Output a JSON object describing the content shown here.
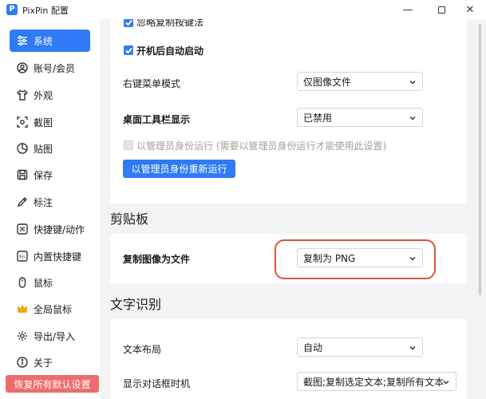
{
  "window": {
    "title": "PixPin 配置",
    "app_icon_letter": "P",
    "minimize_glyph": "—",
    "close_glyph": "✕"
  },
  "sidebar": {
    "items": [
      {
        "label": "系统",
        "icon": "sliders-icon",
        "active": true
      },
      {
        "label": "账号/会员",
        "icon": "user-circle-icon",
        "active": false
      },
      {
        "label": "外观",
        "icon": "shirt-icon",
        "active": false
      },
      {
        "label": "截图",
        "icon": "screenshot-icon",
        "active": false
      },
      {
        "label": "贴图",
        "icon": "pin-image-icon",
        "active": false
      },
      {
        "label": "保存",
        "icon": "save-icon",
        "active": false
      },
      {
        "label": "标注",
        "icon": "annotate-icon",
        "active": false
      },
      {
        "label": "快捷键/动作",
        "icon": "command-key-icon",
        "active": false
      },
      {
        "label": "内置快捷键",
        "icon": "fn-key-icon",
        "active": false
      },
      {
        "label": "鼠标",
        "icon": "mouse-icon",
        "active": false
      },
      {
        "label": "全局鼠标",
        "icon": "crown-icon",
        "active": false
      },
      {
        "label": "导出/导入",
        "icon": "gear-export-icon",
        "active": false
      },
      {
        "label": "关于",
        "icon": "info-icon",
        "active": false
      }
    ],
    "reset_button": "恢复所有默认设置",
    "accent_color": "#2f7bf5",
    "reset_color": "#ef6c6c"
  },
  "system_card": {
    "ignore_copy_key_label": "忽略复制按键法",
    "autostart_label": "开机后自动启动",
    "context_menu_label": "右键菜单模式",
    "context_menu_value": "仅图像文件",
    "desktop_toolbar_label": "桌面工具栏显示",
    "desktop_toolbar_value": "已禁用",
    "run_as_admin_label": "以管理员身份运行 (需要以管理员身份运行才能使用此设置)",
    "restart_admin_button": "以管理员身份重新运行"
  },
  "clipboard": {
    "section_title": "剪贴板",
    "copy_image_label": "复制图像为文件",
    "copy_image_value": "复制为 PNG"
  },
  "ocr": {
    "section_title": "文字识别",
    "text_layout_label": "文本布局",
    "text_layout_value": "自动",
    "show_dialog_label": "显示对话框时机",
    "show_dialog_value": "截图;复制选定文本;复制所有文本"
  },
  "highlight_color": "#d6553a"
}
